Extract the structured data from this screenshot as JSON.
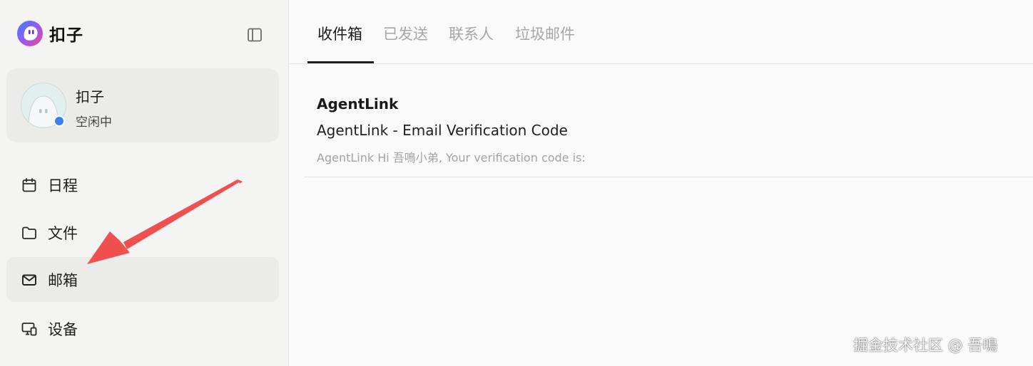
{
  "brand": {
    "name": "扣子",
    "accent_colors": [
      "#8b5cf6",
      "#ec4899",
      "#3b82f6"
    ]
  },
  "sidebar": {
    "toggle_icon": "sidebar-panel-icon",
    "profile": {
      "name": "扣子",
      "status": "空闲中",
      "status_color": "#3b7ef5"
    },
    "items": [
      {
        "label": "日程",
        "icon": "calendar-icon",
        "active": false
      },
      {
        "label": "文件",
        "icon": "folder-icon",
        "active": false
      },
      {
        "label": "邮箱",
        "icon": "mail-icon",
        "active": true
      },
      {
        "label": "设备",
        "icon": "device-icon",
        "active": false
      }
    ]
  },
  "main": {
    "tabs": [
      {
        "label": "收件箱",
        "active": true
      },
      {
        "label": "已发送",
        "active": false
      },
      {
        "label": "联系人",
        "active": false
      },
      {
        "label": "垃圾邮件",
        "active": false
      }
    ],
    "emails": [
      {
        "sender": "AgentLink",
        "subject": "AgentLink - Email Verification Code",
        "preview": "AgentLink Hi 吾鳴小弟, Your verification code is:"
      }
    ]
  },
  "annotation": {
    "arrow_color": "#f04f4f"
  },
  "watermark": "掘金技术社区 @ 吾鳴"
}
